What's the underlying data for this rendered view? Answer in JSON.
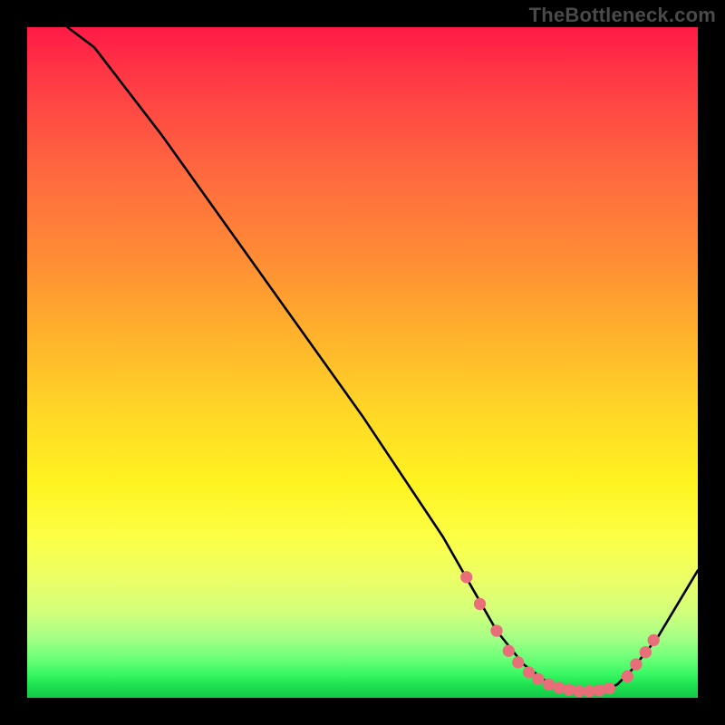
{
  "watermark": "TheBottleneck.com",
  "chart_data": {
    "type": "line",
    "title": "",
    "xlabel": "",
    "ylabel": "",
    "xlim": [
      0,
      100
    ],
    "ylim": [
      0,
      100
    ],
    "grid": false,
    "series": [
      {
        "name": "curve",
        "x": [
          6,
          10,
          20,
          30,
          40,
          50,
          58,
          62,
          66,
          70,
          74,
          78,
          82,
          86,
          88,
          90,
          94,
          100
        ],
        "y": [
          100,
          97,
          84,
          70,
          56,
          42,
          30,
          24,
          17,
          10,
          5,
          2,
          1,
          1,
          2,
          4,
          9,
          19
        ],
        "color": "#000000"
      }
    ],
    "markers": {
      "color": "#e86f7a",
      "radius_pct": 0.9,
      "points": [
        {
          "x": 65.5,
          "y": 18
        },
        {
          "x": 67.5,
          "y": 14
        },
        {
          "x": 70.0,
          "y": 10
        },
        {
          "x": 71.8,
          "y": 7
        },
        {
          "x": 73.2,
          "y": 5.3
        },
        {
          "x": 74.8,
          "y": 3.8
        },
        {
          "x": 76.2,
          "y": 2.8
        },
        {
          "x": 77.8,
          "y": 2.0
        },
        {
          "x": 79.3,
          "y": 1.5
        },
        {
          "x": 80.8,
          "y": 1.2
        },
        {
          "x": 82.3,
          "y": 1.0
        },
        {
          "x": 83.8,
          "y": 1.0
        },
        {
          "x": 85.3,
          "y": 1.1
        },
        {
          "x": 86.8,
          "y": 1.4
        },
        {
          "x": 89.5,
          "y": 3.2
        },
        {
          "x": 90.8,
          "y": 5.0
        },
        {
          "x": 92.2,
          "y": 6.8
        },
        {
          "x": 93.4,
          "y": 8.6
        }
      ]
    },
    "gradient_stops": [
      {
        "pct": 0,
        "color": "#ff1a46"
      },
      {
        "pct": 22,
        "color": "#ff6a3f"
      },
      {
        "pct": 46,
        "color": "#ffb22c"
      },
      {
        "pct": 68,
        "color": "#fff321"
      },
      {
        "pct": 87,
        "color": "#d4ff7a"
      },
      {
        "pct": 100,
        "color": "#14c748"
      }
    ]
  }
}
